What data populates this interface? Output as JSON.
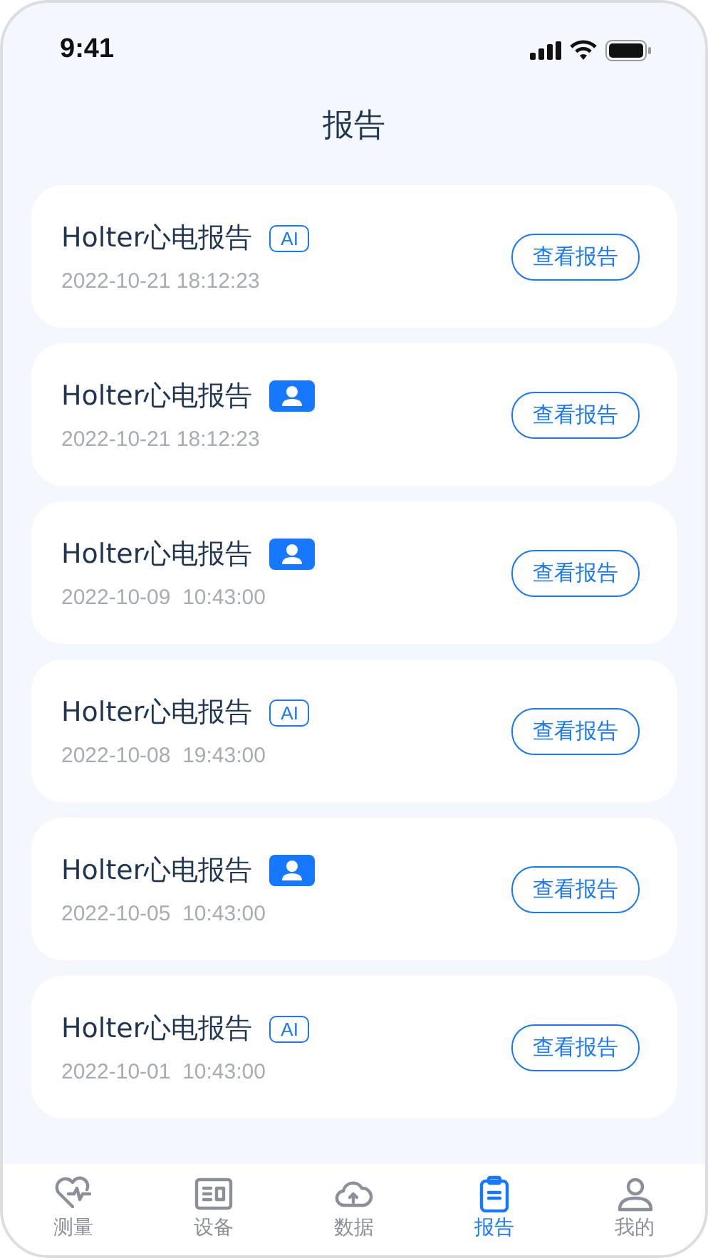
{
  "status_bar": {
    "time": "9:41"
  },
  "header": {
    "title": "报告"
  },
  "reports": [
    {
      "title": "Holter心电报告",
      "badge": {
        "kind": "ai",
        "text": "AI"
      },
      "date": "2022-10-21 18:12:23",
      "button": "查看报告"
    },
    {
      "title": "Holter心电报告",
      "badge": {
        "kind": "doctor"
      },
      "date": "2022-10-21 18:12:23",
      "button": "查看报告"
    },
    {
      "title": "Holter心电报告",
      "badge": {
        "kind": "doctor"
      },
      "date": "2022-10-09  10:43:00",
      "button": "查看报告"
    },
    {
      "title": "Holter心电报告",
      "badge": {
        "kind": "ai",
        "text": "AI"
      },
      "date": "2022-10-08  19:43:00",
      "button": "查看报告"
    },
    {
      "title": "Holter心电报告",
      "badge": {
        "kind": "doctor"
      },
      "date": "2022-10-05  10:43:00",
      "button": "查看报告"
    },
    {
      "title": "Holter心电报告",
      "badge": {
        "kind": "ai",
        "text": "AI"
      },
      "date": "2022-10-01  10:43:00",
      "button": "查看报告"
    }
  ],
  "tab_bar": [
    {
      "kind": "heart",
      "label": "测量",
      "selected": false
    },
    {
      "kind": "device",
      "label": "设备",
      "selected": false
    },
    {
      "kind": "cloud",
      "label": "数据",
      "selected": false
    },
    {
      "kind": "clipboard",
      "label": "报告",
      "selected": true
    },
    {
      "kind": "person",
      "label": "我的",
      "selected": false
    }
  ]
}
